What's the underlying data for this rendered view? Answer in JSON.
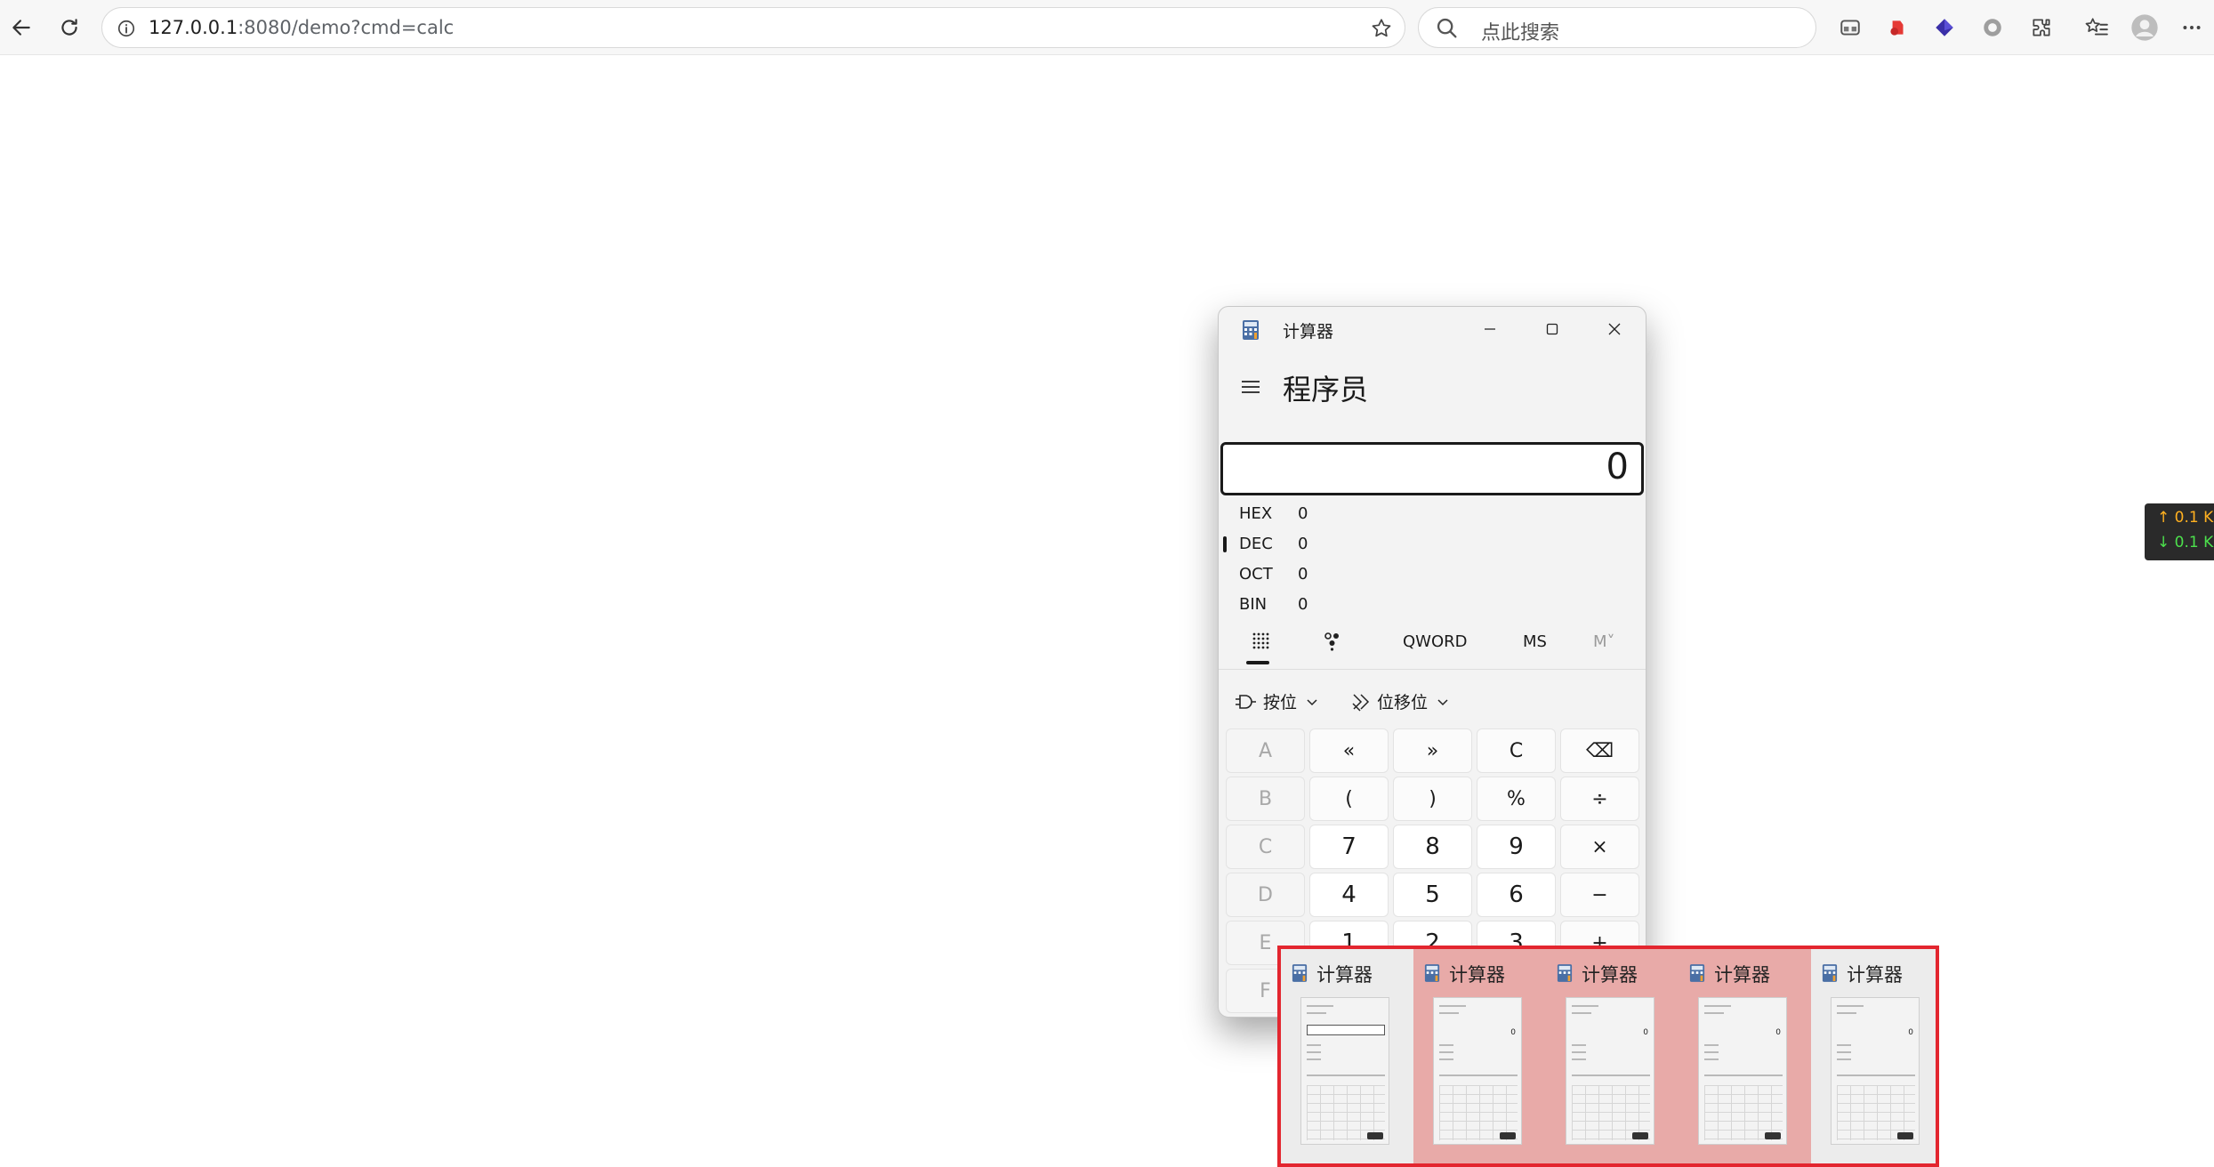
{
  "browser": {
    "url_host": "127.0.0.1",
    "url_rest": ":8080/demo?cmd=calc",
    "search_placeholder": "点此搜索"
  },
  "calculator": {
    "title": "计算器",
    "mode": "程序员",
    "display_value": "0",
    "radix": [
      {
        "name": "HEX",
        "value": "0"
      },
      {
        "name": "DEC",
        "value": "0"
      },
      {
        "name": "OCT",
        "value": "0"
      },
      {
        "name": "BIN",
        "value": "0"
      }
    ],
    "selected_radix": "DEC",
    "word_size": "QWORD",
    "memory_store": "MS",
    "memory_list": "M˅",
    "bitwise_label": "按位",
    "bitshift_label": "位移位",
    "keys": [
      [
        "A",
        "«",
        "»",
        "C",
        "⌫"
      ],
      [
        "B",
        "(",
        ")",
        "%",
        "÷"
      ],
      [
        "C",
        "7",
        "8",
        "9",
        "×"
      ],
      [
        "D",
        "4",
        "5",
        "6",
        "−"
      ],
      [
        "E",
        "1",
        "2",
        "3",
        "+"
      ],
      [
        "F",
        "",
        "",
        "",
        ""
      ]
    ]
  },
  "taskbar_preview": {
    "items": [
      {
        "title": "计算器",
        "highlighted": false
      },
      {
        "title": "计算器",
        "highlighted": true
      },
      {
        "title": "计算器",
        "highlighted": true
      },
      {
        "title": "计算器",
        "highlighted": true
      },
      {
        "title": "计算器",
        "highlighted": false
      }
    ]
  },
  "net_speed": {
    "up": "↑ 0.1 K",
    "down": "↓ 0.1 K"
  },
  "colors": {
    "preview_border": "#e3262f",
    "preview_highlight": "#e8aaa8",
    "accent": "#1a1a1a"
  }
}
